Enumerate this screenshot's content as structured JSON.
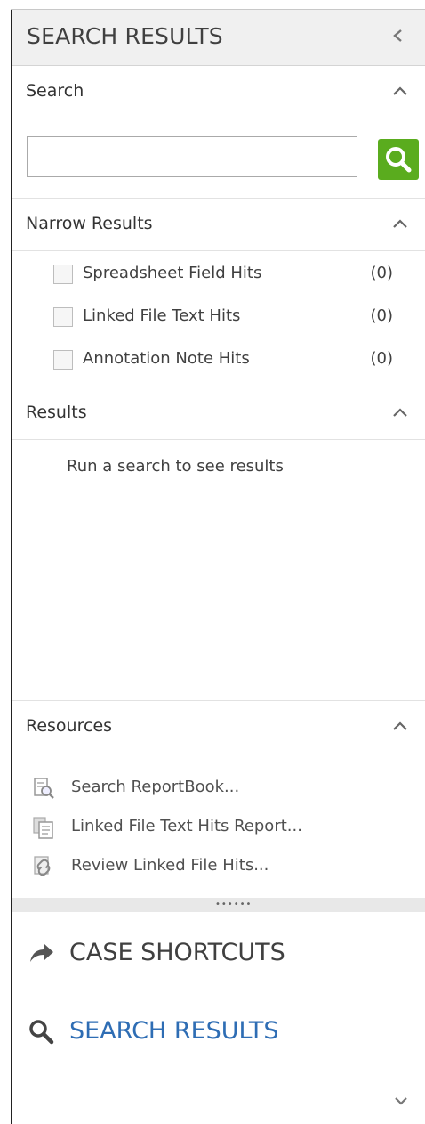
{
  "panel": {
    "title": "SEARCH RESULTS"
  },
  "search": {
    "header": "Search",
    "input_value": "",
    "input_placeholder": ""
  },
  "narrow": {
    "header": "Narrow Results",
    "items": [
      {
        "label": "Spreadsheet Field Hits",
        "count": "(0)",
        "checked": false
      },
      {
        "label": "Linked File Text Hits",
        "count": "(0)",
        "checked": false
      },
      {
        "label": "Annotation Note Hits",
        "count": "(0)",
        "checked": false
      }
    ]
  },
  "results": {
    "header": "Results",
    "empty_message": "Run a search to see results"
  },
  "resources": {
    "header": "Resources",
    "items": [
      {
        "label": "Search ReportBook...",
        "icon": "report-search-icon"
      },
      {
        "label": "Linked File Text Hits Report...",
        "icon": "document-stack-icon"
      },
      {
        "label": "Review Linked File Hits...",
        "icon": "linked-file-icon"
      }
    ]
  },
  "nav": {
    "items": [
      {
        "label": "CASE SHORTCUTS",
        "icon": "share-arrow-icon",
        "active": false
      },
      {
        "label": "SEARCH RESULTS",
        "icon": "magnifier-icon",
        "active": true
      }
    ]
  },
  "colors": {
    "accent_green": "#5aac1e",
    "active_nav_blue": "#2e6db4",
    "nav_text": "#404040"
  }
}
